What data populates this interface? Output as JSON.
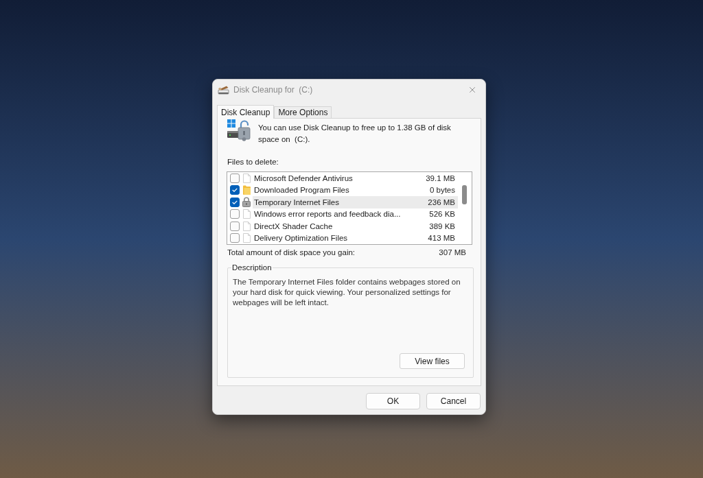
{
  "window": {
    "title": "Disk Cleanup for  (C:)"
  },
  "tabs": [
    {
      "label": "Disk Cleanup",
      "selected": true
    },
    {
      "label": "More Options",
      "selected": false
    }
  ],
  "intro": "You can use Disk Cleanup to free up to 1.38 GB of disk space on  (C:).",
  "files_label": "Files to delete:",
  "files": [
    {
      "kind": "file",
      "name": "Microsoft Defender Antivirus",
      "size": "39.1 MB",
      "checked": false,
      "selected": false
    },
    {
      "kind": "folder",
      "name": "Downloaded Program Files",
      "size": "0 bytes",
      "checked": true,
      "selected": false
    },
    {
      "kind": "locked",
      "name": "Temporary Internet Files",
      "size": "236 MB",
      "checked": true,
      "selected": true
    },
    {
      "kind": "file",
      "name": "Windows error reports and feedback dia...",
      "size": "526 KB",
      "checked": false,
      "selected": false
    },
    {
      "kind": "file",
      "name": "DirectX Shader Cache",
      "size": "389 KB",
      "checked": false,
      "selected": false
    },
    {
      "kind": "file",
      "name": "Delivery Optimization Files",
      "size": "413 MB",
      "checked": false,
      "selected": false
    }
  ],
  "total": {
    "label": "Total amount of disk space you gain:",
    "value": "307 MB"
  },
  "description": {
    "title": "Description",
    "text": "The Temporary Internet Files folder contains webpages stored on your hard disk for quick viewing. Your personalized settings for webpages will be left intact.",
    "button": "View files"
  },
  "buttons": [
    "OK",
    "Cancel"
  ]
}
